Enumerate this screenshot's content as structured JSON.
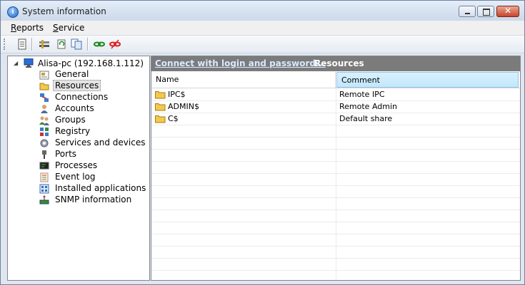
{
  "window": {
    "title": "System information",
    "app_icon": "info-icon"
  },
  "menu": {
    "items": [
      {
        "accel": "R",
        "rest": "eports"
      },
      {
        "accel": "S",
        "rest": "ervice"
      }
    ]
  },
  "toolbar": {
    "icons": [
      "report-icon",
      "settings-icon",
      "refresh-icon",
      "copy-icon",
      "connect-icon",
      "disconnect-icon"
    ]
  },
  "tree": {
    "root": "Alisa-pc (192.168.1.112)",
    "items": [
      {
        "label": "General",
        "icon": "general-icon"
      },
      {
        "label": "Resources",
        "icon": "folder-icon",
        "selected": true
      },
      {
        "label": "Connections",
        "icon": "connections-icon"
      },
      {
        "label": "Accounts",
        "icon": "accounts-icon"
      },
      {
        "label": "Groups",
        "icon": "groups-icon"
      },
      {
        "label": "Registry",
        "icon": "registry-icon"
      },
      {
        "label": "Services and devices",
        "icon": "services-icon"
      },
      {
        "label": "Ports",
        "icon": "ports-icon"
      },
      {
        "label": "Processes",
        "icon": "processes-icon"
      },
      {
        "label": "Event log",
        "icon": "event-log-icon"
      },
      {
        "label": "Installed applications",
        "icon": "applications-icon"
      },
      {
        "label": "SNMP information",
        "icon": "snmp-icon"
      }
    ]
  },
  "header": {
    "connect_link": "Connect with login and password...",
    "title": "Resources"
  },
  "table": {
    "columns": [
      "Name",
      "Comment"
    ],
    "rows": [
      {
        "name": "IPC$",
        "comment": "Remote IPC"
      },
      {
        "name": "ADMIN$",
        "comment": "Remote Admin"
      },
      {
        "name": "C$",
        "comment": "Default share"
      }
    ]
  },
  "colors": {
    "header_bg": "#7b7b7b",
    "link": "#d9e9ff",
    "sort_column_bg": "#c3e7fb",
    "folder": "#f2c94c"
  }
}
